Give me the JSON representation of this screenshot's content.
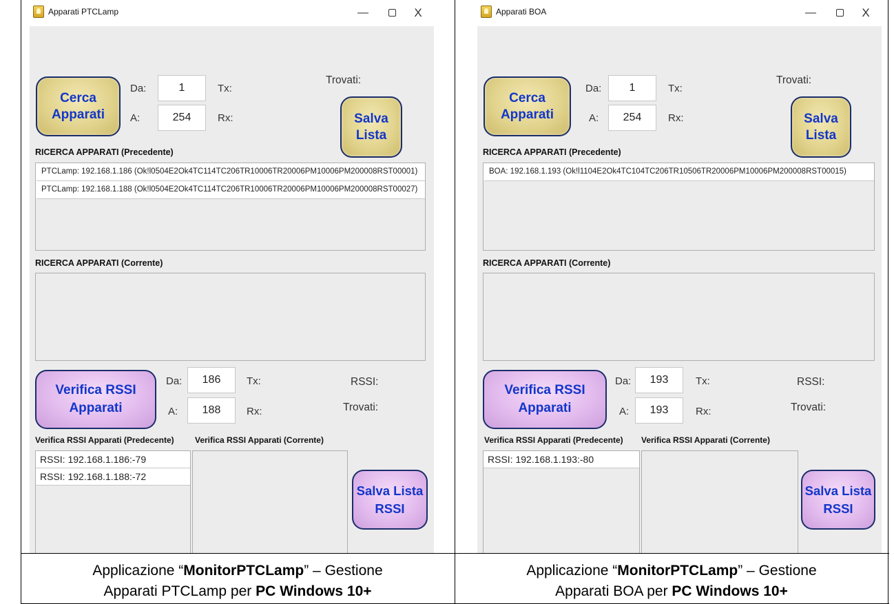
{
  "windows": [
    {
      "title": "Apparati PTCLamp",
      "controls": {
        "minimize": "—",
        "close": "X"
      },
      "search_button": [
        "Cerca",
        "Apparati"
      ],
      "da_label": "Da:",
      "da_value": "1",
      "a_label": "A:",
      "a_value": "254",
      "tx_label": "Tx:",
      "rx_label": "Rx:",
      "trovati_label": "Trovati:",
      "salva_button": [
        "Salva",
        "Lista"
      ],
      "prev_section": "RICERCA APPARATI (Precedente)",
      "prev_items": [
        "PTCLamp: 192.168.1.186 (Ok!l0504E2Ok4TC114TC206TR10006TR20006PM10006PM200008RST00001)",
        "PTCLamp: 192.168.1.188 (Ok!l0504E2Ok4TC114TC206TR10006TR20006PM10006PM200008RST00027)"
      ],
      "curr_section": "RICERCA APPARATI (Corrente)",
      "rssi_button": [
        "Verifica RSSI",
        "Apparati"
      ],
      "rssi_da_label": "Da:",
      "rssi_da_value": "186",
      "rssi_a_label": "A:",
      "rssi_a_value": "188",
      "rssi_tx_label": "Tx:",
      "rssi_rx_label": "Rx:",
      "rssi_label": "RSSI:",
      "rssi_trovati_label": "Trovati:",
      "rssi_prev_section": "Verifica RSSI Apparati (Predecente)",
      "rssi_curr_section": "Verifica RSSI Apparati (Corrente)",
      "rssi_prev_items": [
        "RSSI: 192.168.1.186:-79",
        "RSSI: 192.168.1.188:-72"
      ],
      "salva_rssi_button": [
        "Salva Lista",
        "RSSI"
      ]
    },
    {
      "title": "Apparati BOA",
      "controls": {
        "minimize": "—",
        "close": "X"
      },
      "search_button": [
        "Cerca",
        "Apparati"
      ],
      "da_label": "Da:",
      "da_value": "1",
      "a_label": "A:",
      "a_value": "254",
      "tx_label": "Tx:",
      "rx_label": "Rx:",
      "trovati_label": "Trovati:",
      "salva_button": [
        "Salva",
        "Lista"
      ],
      "prev_section": "RICERCA APPARATI (Precedente)",
      "prev_items": [
        "BOA: 192.168.1.193 (Ok!l1104E2Ok4TC104TC206TR10506TR20006PM10006PM200008RST00015)"
      ],
      "curr_section": "RICERCA APPARATI (Corrente)",
      "rssi_button": [
        "Verifica RSSI",
        "Apparati"
      ],
      "rssi_da_label": "Da:",
      "rssi_da_value": "193",
      "rssi_a_label": "A:",
      "rssi_a_value": "193",
      "rssi_tx_label": "Tx:",
      "rssi_rx_label": "Rx:",
      "rssi_label": "RSSI:",
      "rssi_trovati_label": "Trovati:",
      "rssi_prev_section": "Verifica RSSI Apparati (Predecente)",
      "rssi_curr_section": "Verifica RSSI Apparati (Corrente)",
      "rssi_prev_items": [
        "RSSI: 192.168.1.193:-80"
      ],
      "salva_rssi_button": [
        "Salva Lista",
        "RSSI"
      ]
    }
  ],
  "captions": [
    {
      "pre": "Applicazione  “",
      "bold1": "MonitorPTCLamp",
      "mid": "” – Gestione",
      "line2": "Apparati PTCLamp per ",
      "bold2": "PC Windows 10+"
    },
    {
      "pre": "Applicazione “",
      "bold1": "MonitorPTCLamp",
      "mid": "” – Gestione",
      "line2": "Apparati BOA per ",
      "bold2": "PC Windows 10+"
    }
  ],
  "colors": {
    "button_text": "#1236c9",
    "yellow_button": "#e2d48e",
    "purple_button": "#e3bcee"
  }
}
